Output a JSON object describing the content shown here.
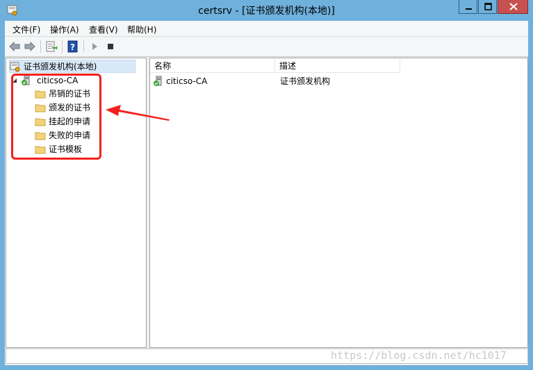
{
  "window": {
    "title": "certsrv - [证书颁发机构(本地)]"
  },
  "menubar": {
    "items": [
      {
        "label": "文件(F)"
      },
      {
        "label": "操作(A)"
      },
      {
        "label": "查看(V)"
      },
      {
        "label": "帮助(H)"
      }
    ]
  },
  "toolbar": {
    "buttons": [
      "back-arrow-icon",
      "forward-arrow-icon",
      "export-list-icon",
      "help-icon",
      "play-icon",
      "stop-icon"
    ]
  },
  "tree": {
    "root": "证书颁发机构(本地)",
    "ca": "citicso-CA",
    "children": [
      {
        "label": "吊销的证书"
      },
      {
        "label": "颁发的证书"
      },
      {
        "label": "挂起的申请"
      },
      {
        "label": "失败的申请"
      },
      {
        "label": "证书模板"
      }
    ]
  },
  "list": {
    "columns": [
      {
        "label": "名称"
      },
      {
        "label": "描述"
      }
    ],
    "rows": [
      {
        "name": "citicso-CA",
        "desc": "证书颁发机构"
      }
    ]
  },
  "watermark": "https://blog.csdn.net/hc1017",
  "colors": {
    "frame": "#6fb0dc",
    "highlight": "#f3201c",
    "selection": "#d9e8f7"
  }
}
